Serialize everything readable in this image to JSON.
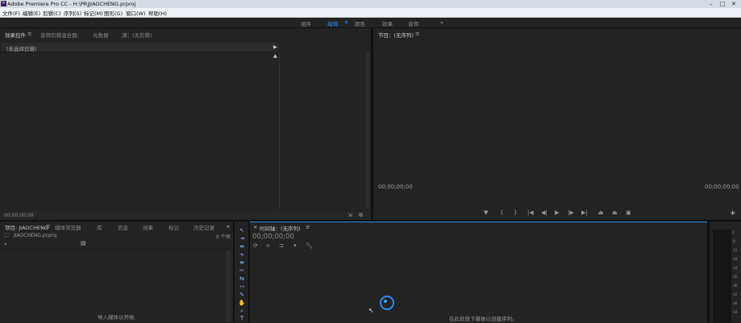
{
  "window": {
    "title": "Adobe Premiere Pro CC - H:\\PRJJIAOCHENG.prproj",
    "app_icon": "Pr"
  },
  "menu": {
    "items": [
      "文件(F)",
      "编辑(E)",
      "剪辑(C)",
      "序列(S)",
      "标记(M)",
      "图形(G)",
      "窗口(W)",
      "帮助(H)"
    ]
  },
  "workspaces": {
    "items": [
      "组件",
      "编辑",
      "颜色",
      "效果",
      "音频"
    ],
    "active_index": 1,
    "more": "»"
  },
  "effect_controls": {
    "tabs": [
      "效果控件",
      "音频剪辑混合器:",
      "元数据",
      "源：(无剪辑)"
    ],
    "row_label": "(未选择剪辑)",
    "timecode": "00;00;00;00"
  },
  "program_monitor": {
    "tab": "节目：(无序列)",
    "timecode_left": "00;00;00;00",
    "timecode_right": "00;00;00;00",
    "add": "+"
  },
  "project": {
    "tabs": [
      "项目: JIAOCHENG",
      "媒体浏览器",
      "库",
      "信息",
      "效果",
      "标记",
      "历史记录"
    ],
    "more": "»",
    "name": "JIAOCHENG.prproj",
    "count": "0 个项",
    "hint": "导入媒体以开始"
  },
  "timeline": {
    "tab": "时间轴：(无序列)",
    "timecode": "00;00;00;00",
    "hint": "在此处放下媒体以创建序列。"
  },
  "meter": {
    "ticks": [
      "0",
      "-6",
      "-12",
      "-18",
      "-24",
      "-30",
      "-36",
      "-42",
      "-48",
      "-54"
    ]
  },
  "colors": {
    "accent": "#2d8ceb",
    "panel": "#232323",
    "border": "#111111"
  }
}
